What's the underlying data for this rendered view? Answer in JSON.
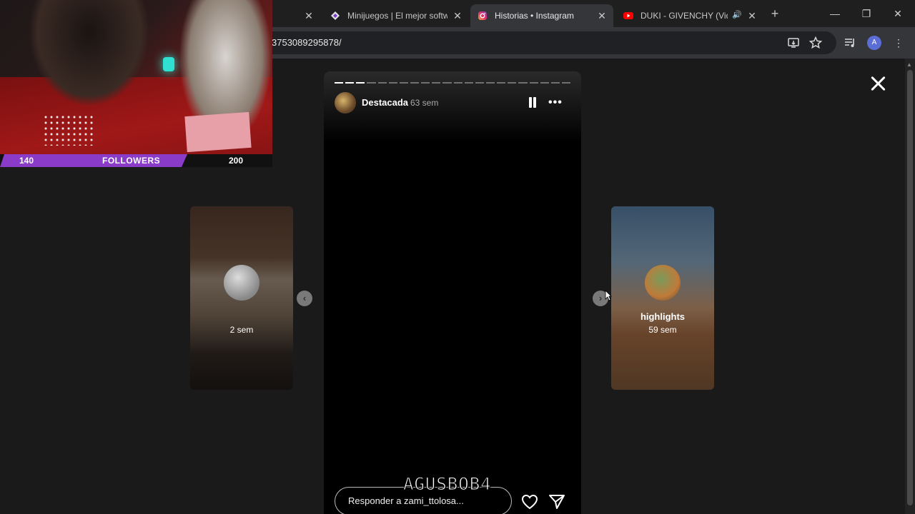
{
  "browser": {
    "tabs": [
      {
        "title": "Minijuegos | El mejor softw",
        "favicon": "diamond-icon",
        "active": false
      },
      {
        "title": "Historias • Instagram",
        "favicon": "instagram-icon",
        "active": true
      },
      {
        "title": "DUKI - GIVENCHY (Vide",
        "favicon": "youtube-icon",
        "active": false
      }
    ],
    "url": "3753089295878/",
    "profile_initial": "A"
  },
  "story": {
    "username": "Destacada",
    "time": "63 sem",
    "reply_placeholder": "Responder a zami_ttolosa...",
    "progress_segments_total": 22,
    "progress_segments_done": 3
  },
  "cards": {
    "left": {
      "time": "2 sem"
    },
    "right": {
      "title": "highlights",
      "time": "59 sem"
    }
  },
  "overlay": {
    "followers_current": "140",
    "followers_label": "FOLLOWERS",
    "followers_goal": "200",
    "watermark": "AGUSBOB4"
  },
  "colors": {
    "followers_bar": "#8a3cc8",
    "background": "#1a1a1a",
    "story_bg": "#000000"
  }
}
